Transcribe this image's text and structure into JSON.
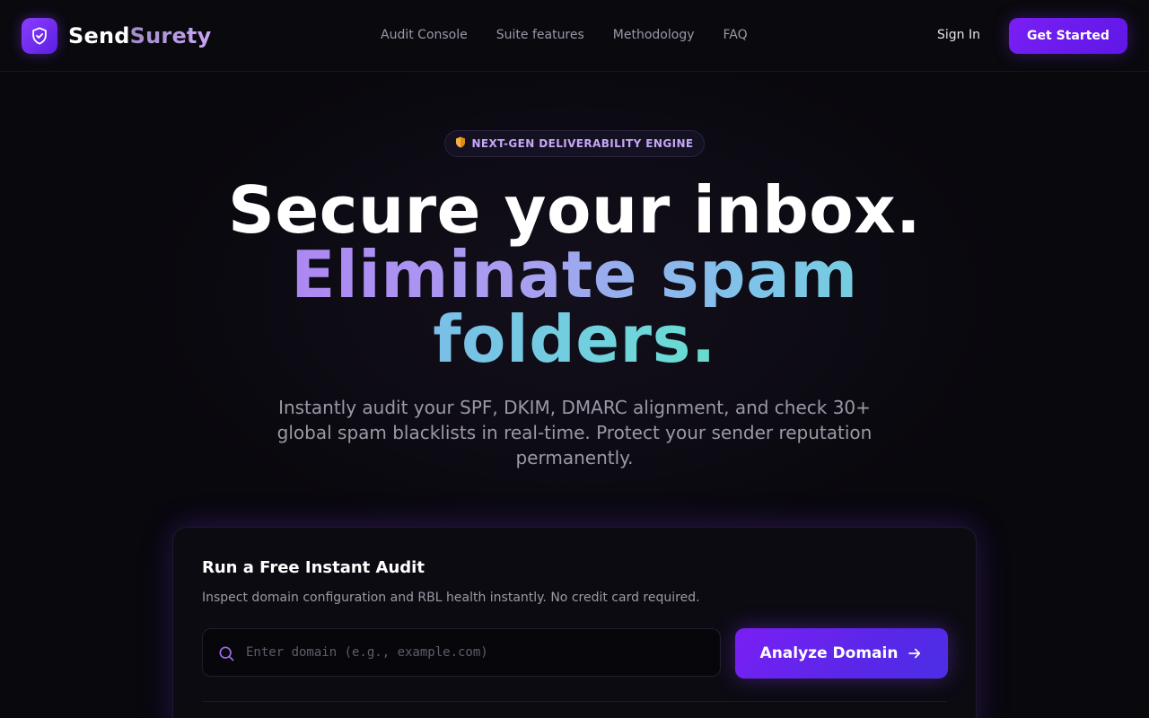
{
  "brand": {
    "name_part1": "Send",
    "name_part2": "Surety",
    "logo_icon": "shield-check-icon"
  },
  "nav": {
    "links": [
      "Audit Console",
      "Suite features",
      "Methodology",
      "FAQ"
    ],
    "sign_in": "Sign In",
    "cta": "Get Started"
  },
  "hero": {
    "badge_icon": "shield-icon",
    "badge_text": "NEXT-GEN DELIVERABILITY ENGINE",
    "headline_line1": "Secure your inbox.",
    "headline_line2": "Eliminate spam",
    "headline_line3": "folders.",
    "subtitle": "Instantly audit your SPF, DKIM, DMARC alignment, and check 30+ global spam blacklists in real-time. Protect your sender reputation permanently."
  },
  "audit": {
    "title": "Run a Free Instant Audit",
    "description": "Inspect domain configuration and RBL health instantly. No credit card required.",
    "input_value": "",
    "input_placeholder": "Enter domain (e.g., example.com)",
    "button_label": "Analyze Domain",
    "button_icon": "arrow-right-icon",
    "search_icon": "search-icon"
  },
  "colors": {
    "background": "#09080d",
    "accent": "#7c3aed",
    "gradient_start": "#b36af5",
    "gradient_end": "#5ce5c5",
    "badge_text": "#c4a8f5"
  }
}
